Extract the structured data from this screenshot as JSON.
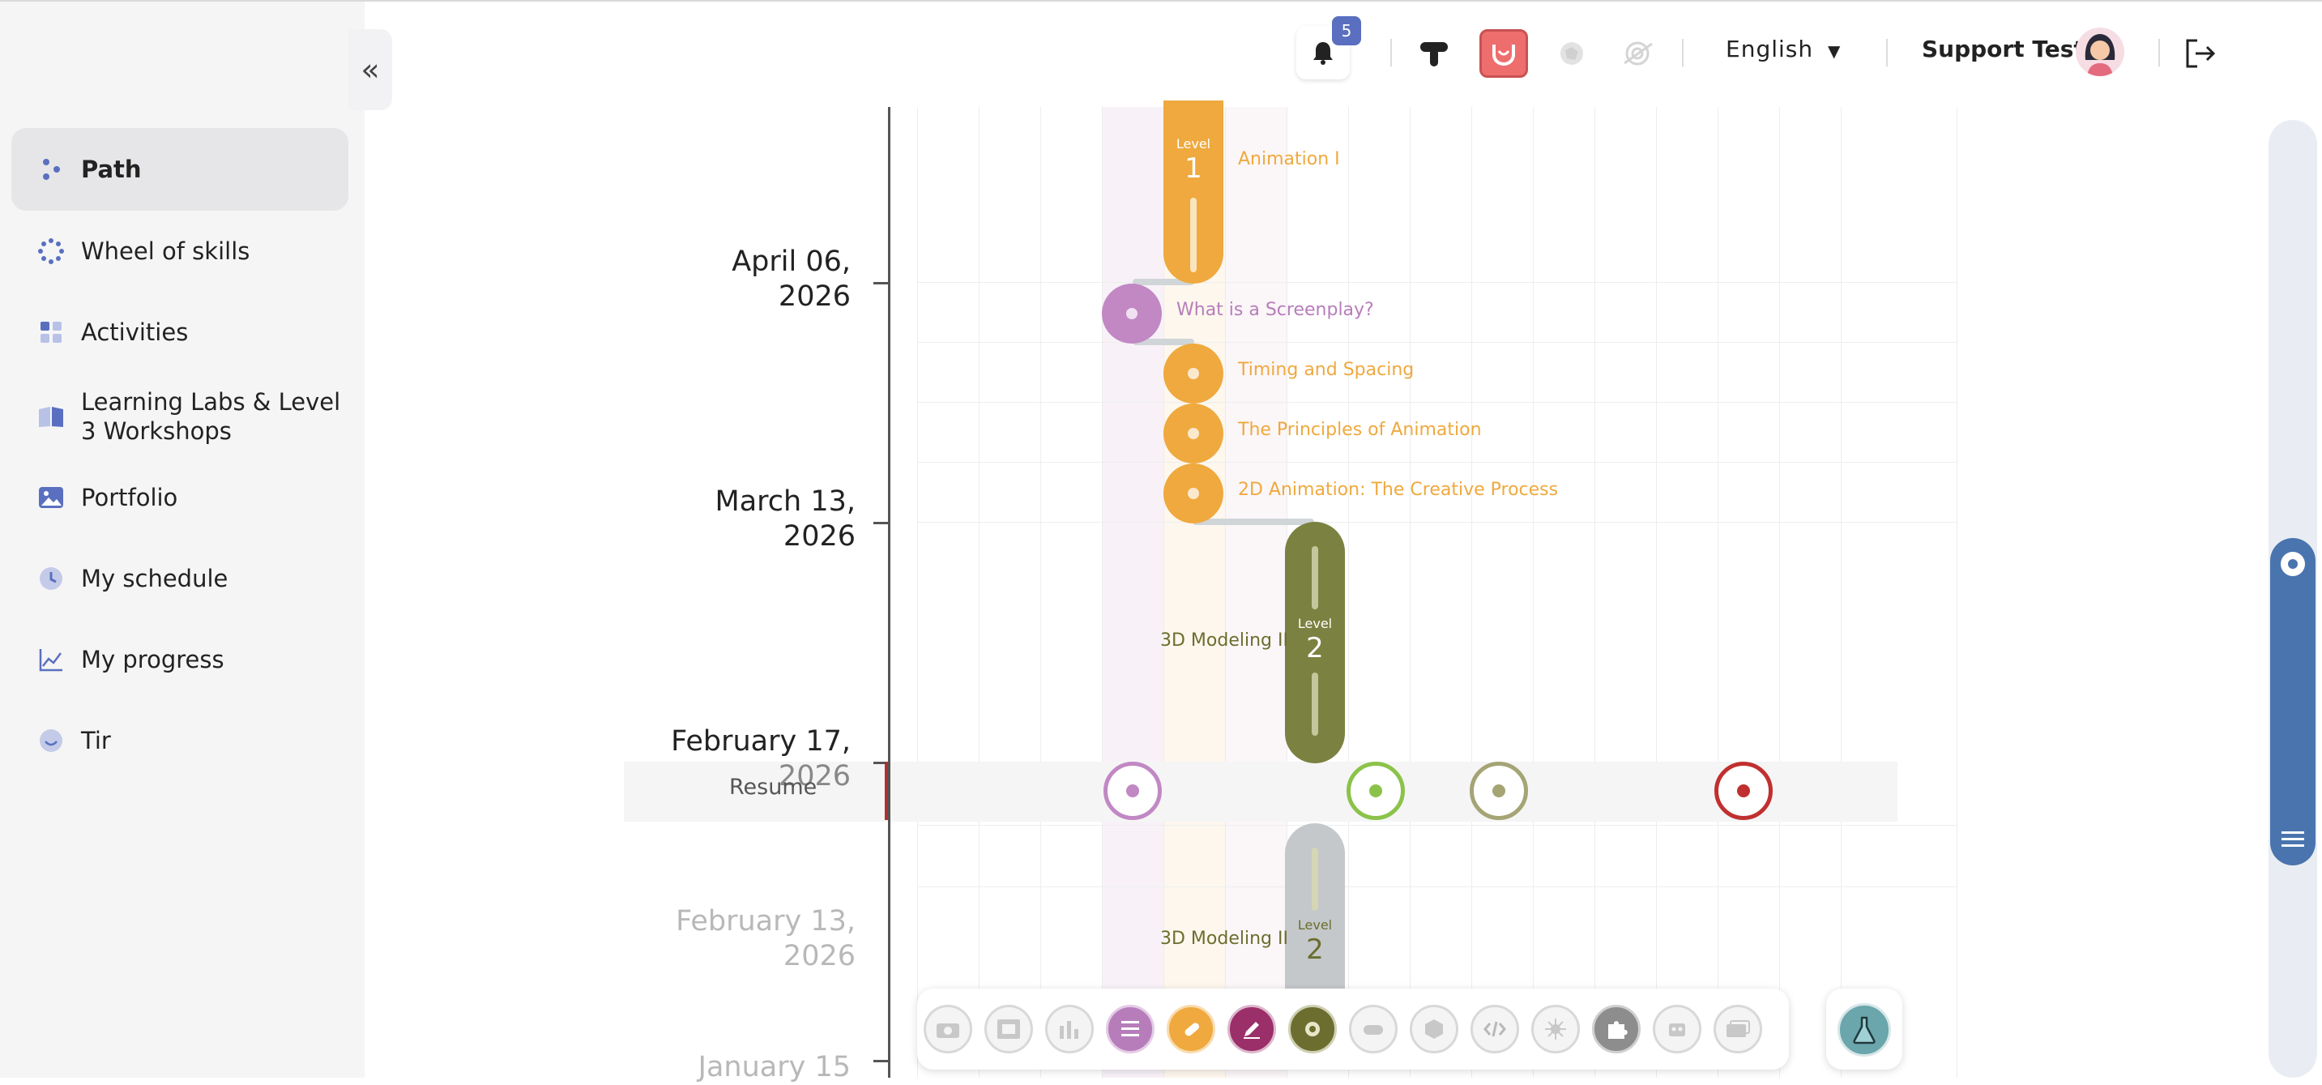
{
  "sidebar": {
    "collapse_icon": "double-chevron-left",
    "items": [
      {
        "label": "Path",
        "icon": "path-icon",
        "active": true
      },
      {
        "label": "Wheel of skills",
        "icon": "wheel-icon"
      },
      {
        "label": "Activities",
        "icon": "activities-icon"
      },
      {
        "label": "Learning Labs & Level 3 Workshops",
        "icon": "book-icon"
      },
      {
        "label": "Portfolio",
        "icon": "image-icon"
      },
      {
        "label": "My schedule",
        "icon": "clock-icon"
      },
      {
        "label": "My progress",
        "icon": "chart-icon"
      },
      {
        "label": "Tir",
        "icon": "smile-icon"
      }
    ]
  },
  "header": {
    "notifications_count": "5",
    "language": "English",
    "user_name": "Support Test"
  },
  "timeline": {
    "dates": [
      {
        "label": "April 06, 2026",
        "line1": "April 06,",
        "line2": "2026"
      },
      {
        "label": "March 13, 2026",
        "line1": "March 13,",
        "line2": "2026"
      },
      {
        "label": "February 17, 2026",
        "line1": "February 17,",
        "line2": "2026"
      },
      {
        "label": "February 13, 2026",
        "line1": "February 13,",
        "line2": "2026"
      },
      {
        "label": "January 15",
        "line1": "January 15",
        "line2": ""
      }
    ],
    "resume_label": "Resume",
    "levels": [
      {
        "level_word": "Level",
        "number": "1",
        "title": "Animation I",
        "color": "#efa93e"
      },
      {
        "level_word": "Level",
        "number": "2",
        "title": "3D Modeling II",
        "color": "#7b8140"
      },
      {
        "level_word": "Level",
        "number": "2",
        "title": "3D Modeling II",
        "color": "#c4c8ca"
      }
    ],
    "activities": [
      {
        "title": "What is a Screenplay?",
        "color": "#b77dbb"
      },
      {
        "title": "Timing and Spacing",
        "color": "#efa93e"
      },
      {
        "title": "The Principles of Animation",
        "color": "#efa93e"
      },
      {
        "title": "2D Animation: The Creative Process",
        "color": "#efa93e"
      }
    ],
    "resume_nodes": [
      {
        "name": "purple",
        "color": "#b77dbb"
      },
      {
        "name": "green",
        "color": "#8bc34a"
      },
      {
        "name": "olive",
        "color": "#a4a475"
      },
      {
        "name": "red",
        "color": "#c0302f"
      }
    ]
  },
  "toolbar": {
    "buttons": [
      {
        "name": "photography",
        "color": "#f2f2f2",
        "active": false
      },
      {
        "name": "film",
        "color": "#f2f2f2",
        "active": false
      },
      {
        "name": "music",
        "color": "#f2f2f2",
        "active": false
      },
      {
        "name": "writing",
        "color": "#b77dbb",
        "active": true
      },
      {
        "name": "animation",
        "color": "#efa93e",
        "active": true
      },
      {
        "name": "design",
        "color": "#9b2f6a",
        "active": true
      },
      {
        "name": "3d-modeling",
        "color": "#6b6e2e",
        "active": true
      },
      {
        "name": "game",
        "color": "#f2f2f2",
        "active": false
      },
      {
        "name": "3d-print",
        "color": "#f2f2f2",
        "active": false
      },
      {
        "name": "code",
        "color": "#f2f2f2",
        "active": false
      },
      {
        "name": "electronics",
        "color": "#f2f2f2",
        "active": false
      },
      {
        "name": "puzzle",
        "color": "#8d8d8d",
        "active": true
      },
      {
        "name": "robotics",
        "color": "#f2f2f2",
        "active": false
      },
      {
        "name": "vr",
        "color": "#f2f2f2",
        "active": false
      }
    ],
    "lab_button": "flask-icon"
  }
}
